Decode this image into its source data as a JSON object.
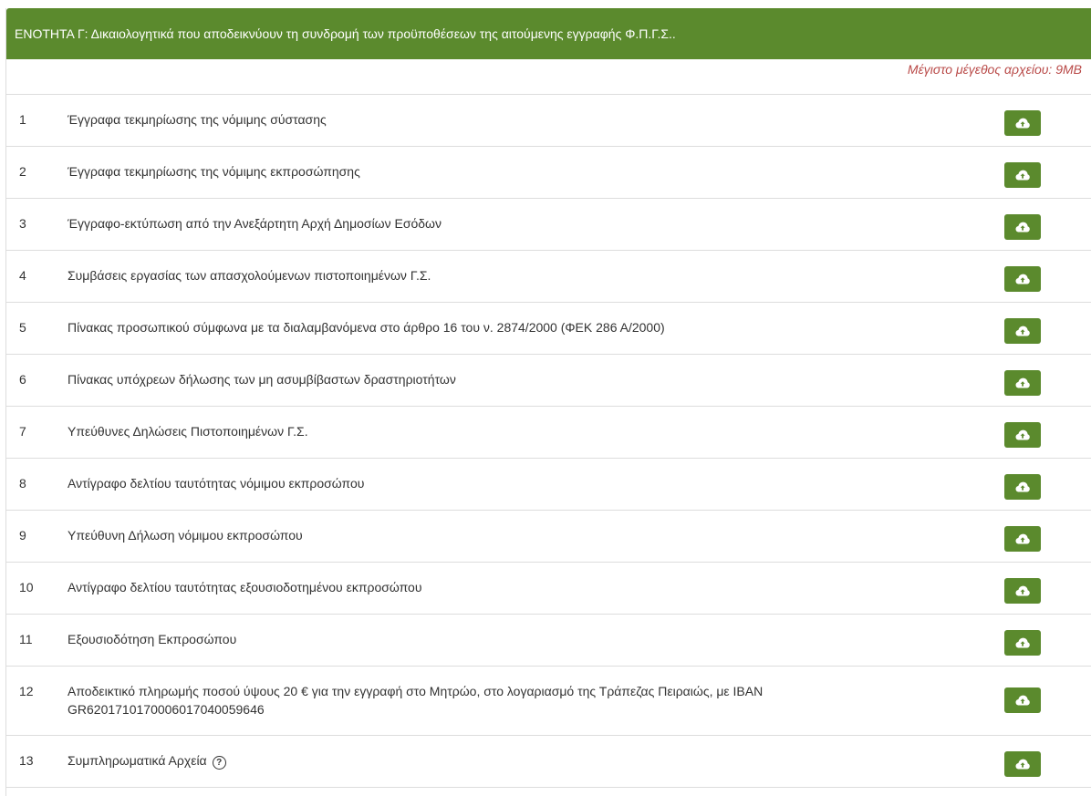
{
  "section": {
    "title": "ΕΝΟΤΗΤΑ Γ: Δικαιολογητικά που αποδεικνύουν τη συνδρομή των προϋποθέσεων της αιτούμενης εγγραφής Φ.Π.Γ.Σ..",
    "max_size_note": "Μέγιστο μέγεθος αρχείου: 9MB"
  },
  "colors": {
    "accent": "#5b8a2d",
    "warning_text": "#b94a48"
  },
  "icons": {
    "upload": "cloud-upload-icon",
    "help": "question-circle-icon"
  },
  "documents": [
    {
      "num": "1",
      "label": "Έγγραφα τεκμηρίωσης της νόμιμης σύστασης"
    },
    {
      "num": "2",
      "label": "Έγγραφα τεκμηρίωσης της νόμιμης εκπροσώπησης"
    },
    {
      "num": "3",
      "label": "Έγγραφο-εκτύπωση από την Ανεξάρτητη Αρχή Δημοσίων Εσόδων"
    },
    {
      "num": "4",
      "label": "Συμβάσεις εργασίας των απασχολούμενων πιστοποιημένων Γ.Σ."
    },
    {
      "num": "5",
      "label": "Πίνακας προσωπικού σύμφωνα με τα διαλαμβανόμενα στο άρθρο 16 του ν. 2874/2000 (ΦΕΚ 286 Α/2000)"
    },
    {
      "num": "6",
      "label": "Πίνακας υπόχρεων δήλωσης των μη ασυμβίβαστων δραστηριοτήτων"
    },
    {
      "num": "7",
      "label": "Υπεύθυνες Δηλώσεις Πιστοποιημένων Γ.Σ."
    },
    {
      "num": "8",
      "label": "Αντίγραφο δελτίου ταυτότητας νόμιμου εκπροσώπου"
    },
    {
      "num": "9",
      "label": "Υπεύθυνη Δήλωση νόμιμου εκπροσώπου"
    },
    {
      "num": "10",
      "label": "Αντίγραφο δελτίου ταυτότητας εξουσιοδοτημένου εκπροσώπου"
    },
    {
      "num": "11",
      "label": "Εξουσιοδότηση Εκπροσώπου"
    },
    {
      "num": "12",
      "label": "Αποδεικτικό πληρωμής ποσού ύψους 20 € για την εγγραφή στο Μητρώο, στο λογαριασμό της Τράπεζας Πειραιώς, με IBAN GR6201710170006017040059646"
    },
    {
      "num": "13",
      "label": "Συμπληρωματικά Αρχεία"
    }
  ]
}
